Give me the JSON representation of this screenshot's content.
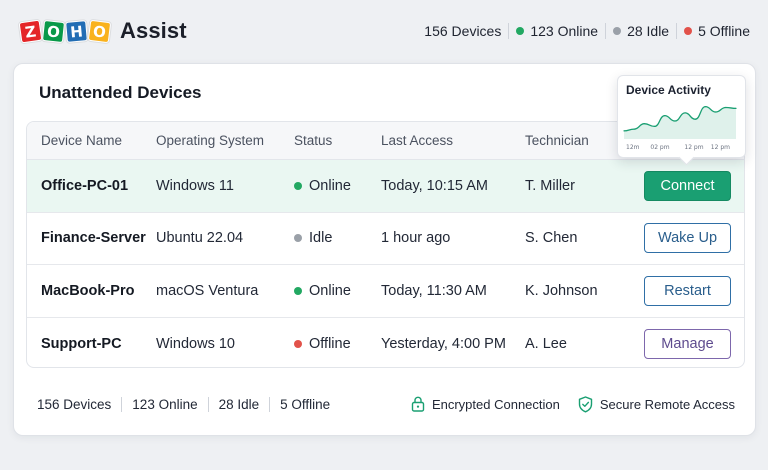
{
  "brand": {
    "logo_letters": [
      "Z",
      "O",
      "H",
      "O"
    ],
    "logo_colors": [
      "#e42527",
      "#089949",
      "#226db4",
      "#f9b21d"
    ],
    "app_name": "Assist"
  },
  "header_stats": [
    {
      "label": "156 Devices",
      "dot": null
    },
    {
      "label": "123 Online",
      "dot": "#22a862"
    },
    {
      "label": "28 Idle",
      "dot": "#9aa0a8"
    },
    {
      "label": "5 Offline",
      "dot": "#e2524a"
    }
  ],
  "card": {
    "title": "Unattended Devices",
    "columns": [
      "Device Name",
      "Operating System",
      "Status",
      "Last Access",
      "Technician"
    ],
    "rows": [
      {
        "device": "Office-PC-01",
        "os": "Windows 11",
        "status": "Online",
        "status_color": "#22a862",
        "last_access": "Today, 10:15 AM",
        "technician": "T. Miller",
        "action": "Connect",
        "action_style": "primary",
        "highlighted": true
      },
      {
        "device": "Finance-Server",
        "os": "Ubuntu 22.04",
        "status": "Idle",
        "status_color": "#9aa0a8",
        "last_access": "1 hour ago",
        "technician": "S. Chen",
        "action": "Wake Up",
        "action_style": "outline-blue",
        "highlighted": false
      },
      {
        "device": "MacBook-Pro",
        "os": "macOS Ventura",
        "status": "Online",
        "status_color": "#22a862",
        "last_access": "Today, 11:30 AM",
        "technician": "K. Johnson",
        "action": "Restart",
        "action_style": "outline-blue",
        "highlighted": false
      },
      {
        "device": "Support-PC",
        "os": "Windows 10",
        "status": "Offline",
        "status_color": "#e2524a",
        "last_access": "Yesterday, 4:00 PM",
        "technician": "A. Lee",
        "action": "Manage",
        "action_style": "outline-purple",
        "highlighted": false
      }
    ]
  },
  "footer": {
    "stats": [
      "156 Devices",
      "123 Online",
      "28 Idle",
      "5 Offline"
    ],
    "security": [
      {
        "label": "Encrypted Connection",
        "icon": "lock-icon"
      },
      {
        "label": "Secure Remote Access",
        "icon": "shield-check-icon"
      }
    ]
  },
  "chart_data": {
    "type": "area",
    "title": "Device Activity",
    "x": [
      "12m",
      "02 pm",
      "12 pm",
      "12 pm"
    ],
    "values": [
      18,
      22,
      34,
      28,
      52,
      40,
      58,
      44,
      72,
      60,
      70,
      68
    ],
    "ylim": [
      0,
      80
    ],
    "grid": false,
    "color": "#1a9f72"
  }
}
